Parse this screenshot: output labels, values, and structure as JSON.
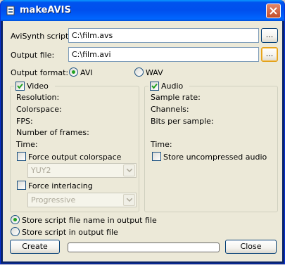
{
  "window": {
    "title": "makeAVIS"
  },
  "avisynth": {
    "label": "AviSynth script:",
    "value": "C:\\film.avs",
    "browse_label": "..."
  },
  "output": {
    "label": "Output file:",
    "value": "C:\\film.avi",
    "browse_label": "..."
  },
  "format": {
    "label": "Output format:",
    "options": [
      "AVI",
      "WAV"
    ],
    "selected": "AVI"
  },
  "video": {
    "checkbox_label": "Video",
    "checked": true,
    "fields": [
      "Resolution:",
      "Colorspace:",
      "FPS:",
      "Number of frames:",
      "Time:"
    ],
    "force_colorspace": {
      "label": "Force output colorspace",
      "checked": false,
      "value": "YUY2"
    },
    "force_interlacing": {
      "label": "Force interlacing",
      "checked": false,
      "value": "Progressive"
    }
  },
  "audio": {
    "checkbox_label": "Audio",
    "checked": true,
    "fields": [
      "Sample rate:",
      "Channels:",
      "Bits per sample:",
      "Time:"
    ],
    "store_uncompressed": {
      "label": "Store uncompressed audio",
      "checked": false
    }
  },
  "store": {
    "options": [
      "Store script file name in output file",
      "Store script in output file"
    ],
    "selected": 0
  },
  "buttons": {
    "create": "Create",
    "close": "Close"
  },
  "progress": {
    "value": 0
  },
  "colors": {
    "title_bar": "#0054e3",
    "dialog_bg": "#ece9d8",
    "radio_dot": "#21a121",
    "focus_border": "#e3a21a"
  }
}
